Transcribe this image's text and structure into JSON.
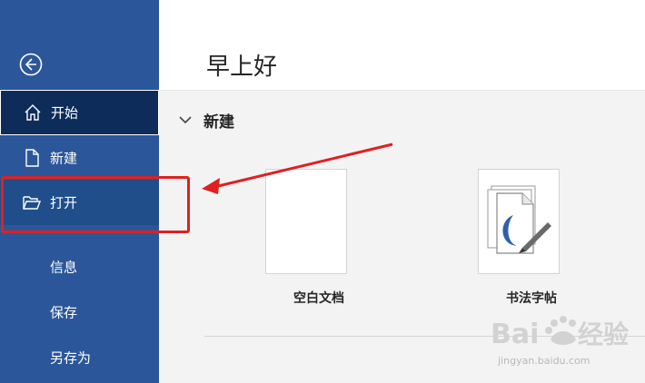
{
  "sidebar": {
    "items": [
      {
        "label": "开始",
        "icon": "home-icon"
      },
      {
        "label": "新建",
        "icon": "document-icon"
      },
      {
        "label": "打开",
        "icon": "folder-open-icon"
      },
      {
        "label": "信息"
      },
      {
        "label": "保存"
      },
      {
        "label": "另存为"
      }
    ],
    "back_icon": "back-arrow-icon"
  },
  "header": {
    "greeting": "早上好"
  },
  "new_section": {
    "title": "新建",
    "toggle_icon": "chevron-down-icon",
    "templates": [
      {
        "label": "空白文档"
      },
      {
        "label": "书法字帖"
      }
    ]
  },
  "colors": {
    "sidebar": "#2b579a",
    "sidebar_selected": "#0e2c5a",
    "annotation": "#e02020",
    "main_bg": "#f3f3f3"
  },
  "watermark": {
    "logo": "Bai du 经验",
    "url": "jingyan.baidu.com"
  }
}
